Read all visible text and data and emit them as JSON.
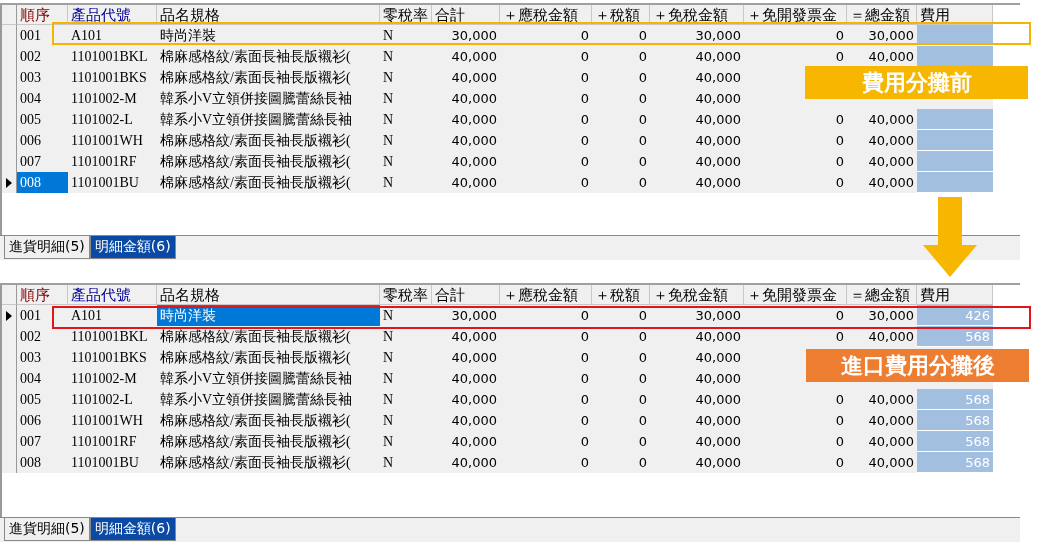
{
  "panels": [
    {
      "columns": [
        {
          "label": "順序",
          "color": "#800000",
          "kind": "text",
          "focused": true
        },
        {
          "label": "產品代號",
          "color": "#000099",
          "kind": "text",
          "focused": false
        },
        {
          "label": "品名規格",
          "color": "#000000",
          "kind": "text",
          "focused": false
        },
        {
          "label": "零稅率",
          "color": "#000000",
          "kind": "text",
          "focused": false
        },
        {
          "label": "合計",
          "color": "#000000",
          "kind": "number",
          "focused": false
        },
        {
          "label": "＋應稅金額",
          "color": "#000000",
          "kind": "number",
          "focused": false
        },
        {
          "label": "＋稅額",
          "color": "#000000",
          "kind": "number",
          "focused": false
        },
        {
          "label": "＋免稅金額",
          "color": "#000000",
          "kind": "number",
          "focused": false
        },
        {
          "label": "＋免開發票金",
          "color": "#000000",
          "kind": "number",
          "focused": false
        },
        {
          "label": "＝總金額",
          "color": "#000000",
          "kind": "number",
          "focused": false
        },
        {
          "label": "費用",
          "color": "#000000",
          "kind": "fee",
          "focused": false
        }
      ],
      "rows": [
        {
          "current": false,
          "cells": [
            "001",
            "A101",
            "時尚洋裝",
            "N",
            "30,000",
            "0",
            "0",
            "30,000",
            "0",
            "30,000"
          ]
        },
        {
          "current": false,
          "cells": [
            "002",
            "1101001BKL",
            "棉麻感格紋/素面長袖長版襯衫(",
            "N",
            "40,000",
            "0",
            "0",
            "40,000",
            "0",
            "40,000"
          ]
        },
        {
          "current": false,
          "cells": [
            "003",
            "1101001BKS",
            "棉麻感格紋/素面長袖長版襯衫(",
            "N",
            "40,000",
            "0",
            "0",
            "40,000"
          ]
        },
        {
          "current": false,
          "cells": [
            "004",
            "1101002-M",
            "韓系小V立領併接圖騰蕾絲長袖",
            "N",
            "40,000",
            "0",
            "0",
            "40,000"
          ]
        },
        {
          "current": false,
          "cells": [
            "005",
            "1101002-L",
            "韓系小V立領併接圖騰蕾絲長袖",
            "N",
            "40,000",
            "0",
            "0",
            "40,000",
            "0",
            "40,000"
          ]
        },
        {
          "current": false,
          "cells": [
            "006",
            "1101001WH",
            "棉麻感格紋/素面長袖長版襯衫(",
            "N",
            "40,000",
            "0",
            "0",
            "40,000",
            "0",
            "40,000"
          ]
        },
        {
          "current": false,
          "cells": [
            "007",
            "1101001RF",
            "棉麻感格紋/素面長袖長版襯衫(",
            "N",
            "40,000",
            "0",
            "0",
            "40,000",
            "0",
            "40,000"
          ]
        },
        {
          "current": true,
          "cells": [
            "008",
            "1101001BU",
            "棉麻感格紋/素面長袖長版襯衫(",
            "N",
            "40,000",
            "0",
            "0",
            "40,000",
            "0",
            "40,000"
          ]
        }
      ],
      "tabs": [
        {
          "label": "進貨明細(5)",
          "selected": false
        },
        {
          "label": "明細金額(6)",
          "selected": true
        }
      ],
      "callout": {
        "text": "費用分攤前",
        "color": "#f7b600"
      },
      "highlight": {
        "color": "#f4b400"
      }
    },
    {
      "columns": [
        {
          "label": "順序",
          "color": "#800000",
          "kind": "text",
          "focused": false
        },
        {
          "label": "產品代號",
          "color": "#000099",
          "kind": "text",
          "focused": false
        },
        {
          "label": "品名規格",
          "color": "#000000",
          "kind": "text",
          "focused": true
        },
        {
          "label": "零稅率",
          "color": "#000000",
          "kind": "text",
          "focused": false
        },
        {
          "label": "合計",
          "color": "#000000",
          "kind": "number",
          "focused": false
        },
        {
          "label": "＋應稅金額",
          "color": "#000000",
          "kind": "number",
          "focused": false
        },
        {
          "label": "＋稅額",
          "color": "#000000",
          "kind": "number",
          "focused": false
        },
        {
          "label": "＋免稅金額",
          "color": "#000000",
          "kind": "number",
          "focused": false
        },
        {
          "label": "＋免開發票金",
          "color": "#000000",
          "kind": "number",
          "focused": false
        },
        {
          "label": "＝總金額",
          "color": "#000000",
          "kind": "number",
          "focused": false
        },
        {
          "label": "費用",
          "color": "#000000",
          "kind": "fee",
          "focused": false
        }
      ],
      "rows": [
        {
          "current": true,
          "cells": [
            "001",
            "A101",
            "時尚洋裝",
            "N",
            "30,000",
            "0",
            "0",
            "30,000",
            "0",
            "30,000",
            "426"
          ]
        },
        {
          "current": false,
          "cells": [
            "002",
            "1101001BKL",
            "棉麻感格紋/素面長袖長版襯衫(",
            "N",
            "40,000",
            "0",
            "0",
            "40,000",
            "0",
            "40,000",
            "568"
          ]
        },
        {
          "current": false,
          "cells": [
            "003",
            "1101001BKS",
            "棉麻感格紋/素面長袖長版襯衫(",
            "N",
            "40,000",
            "0",
            "0",
            "40,000"
          ]
        },
        {
          "current": false,
          "cells": [
            "004",
            "1101002-M",
            "韓系小V立領併接圖騰蕾絲長袖",
            "N",
            "40,000",
            "0",
            "0",
            "40,000"
          ]
        },
        {
          "current": false,
          "cells": [
            "005",
            "1101002-L",
            "韓系小V立領併接圖騰蕾絲長袖",
            "N",
            "40,000",
            "0",
            "0",
            "40,000",
            "0",
            "40,000",
            "568"
          ]
        },
        {
          "current": false,
          "cells": [
            "006",
            "1101001WH",
            "棉麻感格紋/素面長袖長版襯衫(",
            "N",
            "40,000",
            "0",
            "0",
            "40,000",
            "0",
            "40,000",
            "568"
          ]
        },
        {
          "current": false,
          "cells": [
            "007",
            "1101001RF",
            "棉麻感格紋/素面長袖長版襯衫(",
            "N",
            "40,000",
            "0",
            "0",
            "40,000",
            "0",
            "40,000",
            "568"
          ]
        },
        {
          "current": false,
          "cells": [
            "008",
            "1101001BU",
            "棉麻感格紋/素面長袖長版襯衫(",
            "N",
            "40,000",
            "0",
            "0",
            "40,000",
            "0",
            "40,000",
            "568"
          ]
        }
      ],
      "tabs": [
        {
          "label": "進貨明細(5)",
          "selected": false
        },
        {
          "label": "明細金額(6)",
          "selected": true
        }
      ],
      "callout": {
        "text": "進口費用分攤後",
        "color": "#ed7d31"
      },
      "highlight": {
        "color": "#e0161b"
      }
    }
  ]
}
